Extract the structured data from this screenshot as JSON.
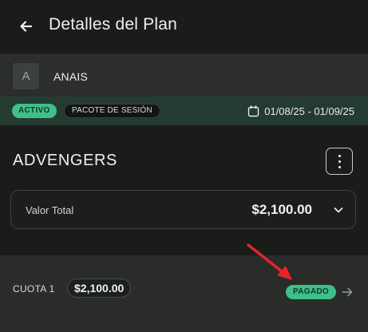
{
  "header": {
    "title": "Detalles del Plan",
    "back_icon": "arrow-left-icon"
  },
  "user": {
    "avatar_letter": "A",
    "name": "ANAIS"
  },
  "status": {
    "state": "ACTIVO",
    "plan_type": "PACOTE DE SESIÓN",
    "calendar_icon": "calendar-icon",
    "date_range": "01/08/25 - 01/09/25"
  },
  "plan": {
    "name": "ADVENGERS",
    "menu_icon": "more-vertical-icon",
    "total_label": "Valor Total",
    "total_value": "$2,100.00",
    "expand_icon": "chevron-down-icon"
  },
  "installments": [
    {
      "label": "CUOTA 1",
      "amount": "$2,100.00",
      "status": "PAGADO",
      "nav_icon": "arrow-right-icon"
    }
  ],
  "colors": {
    "background": "#1a1c1a",
    "accent_green": "#3fbf8a",
    "status_band": "#233b31",
    "annotation": "#e8232a"
  }
}
